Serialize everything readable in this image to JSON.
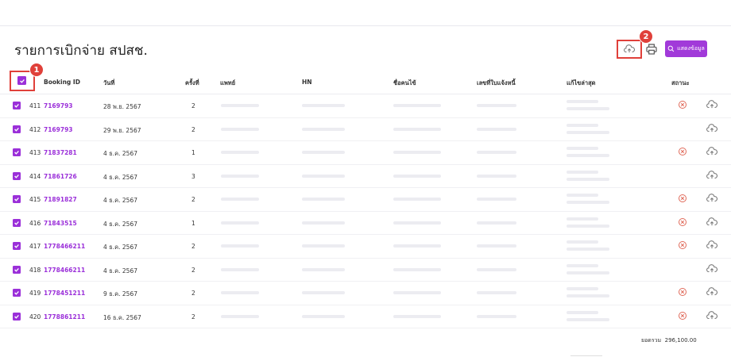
{
  "header": {
    "title": "รายการเบิกจ่าย สปสช.",
    "show_button_label": "แสดงข้อมูล"
  },
  "markers": {
    "one": "1",
    "two": "2"
  },
  "table": {
    "columns": [
      "Booking ID",
      "วันที่",
      "ครั้งที่",
      "แพทย์",
      "HN",
      "ชื่อคนไข้",
      "เลขที่ใบแจ้งหนี้",
      "แก้ไขล่าสุด",
      "สถานะ"
    ],
    "rows": [
      {
        "no": "411",
        "booking_id": "7169793",
        "date": "28 พ.ย. 2567",
        "times": "2",
        "status": true
      },
      {
        "no": "412",
        "booking_id": "7169793",
        "date": "29 พ.ย. 2567",
        "times": "2",
        "status": false
      },
      {
        "no": "413",
        "booking_id": "71837281",
        "date": "4 ธ.ค. 2567",
        "times": "1",
        "status": true
      },
      {
        "no": "414",
        "booking_id": "71861726",
        "date": "4 ธ.ค. 2567",
        "times": "3",
        "status": false
      },
      {
        "no": "415",
        "booking_id": "71891827",
        "date": "4 ธ.ค. 2567",
        "times": "2",
        "status": true
      },
      {
        "no": "416",
        "booking_id": "71843515",
        "date": "4 ธ.ค. 2567",
        "times": "1",
        "status": true
      },
      {
        "no": "417",
        "booking_id": "1778466211",
        "date": "4 ธ.ค. 2567",
        "times": "2",
        "status": true
      },
      {
        "no": "418",
        "booking_id": "1778466211",
        "date": "4 ธ.ค. 2567",
        "times": "2",
        "status": false
      },
      {
        "no": "419",
        "booking_id": "1778451211",
        "date": "9 ธ.ค. 2567",
        "times": "2",
        "status": true
      },
      {
        "no": "420",
        "booking_id": "1778861211",
        "date": "16 ธ.ค. 2567",
        "times": "2",
        "status": true
      }
    ]
  },
  "footer": {
    "total_label": "ยอดรวม",
    "total_value": "296,100.00"
  },
  "colors": {
    "accent": "#9b30d9",
    "marker": "#e0403a",
    "status_error": "#e06a5a"
  }
}
